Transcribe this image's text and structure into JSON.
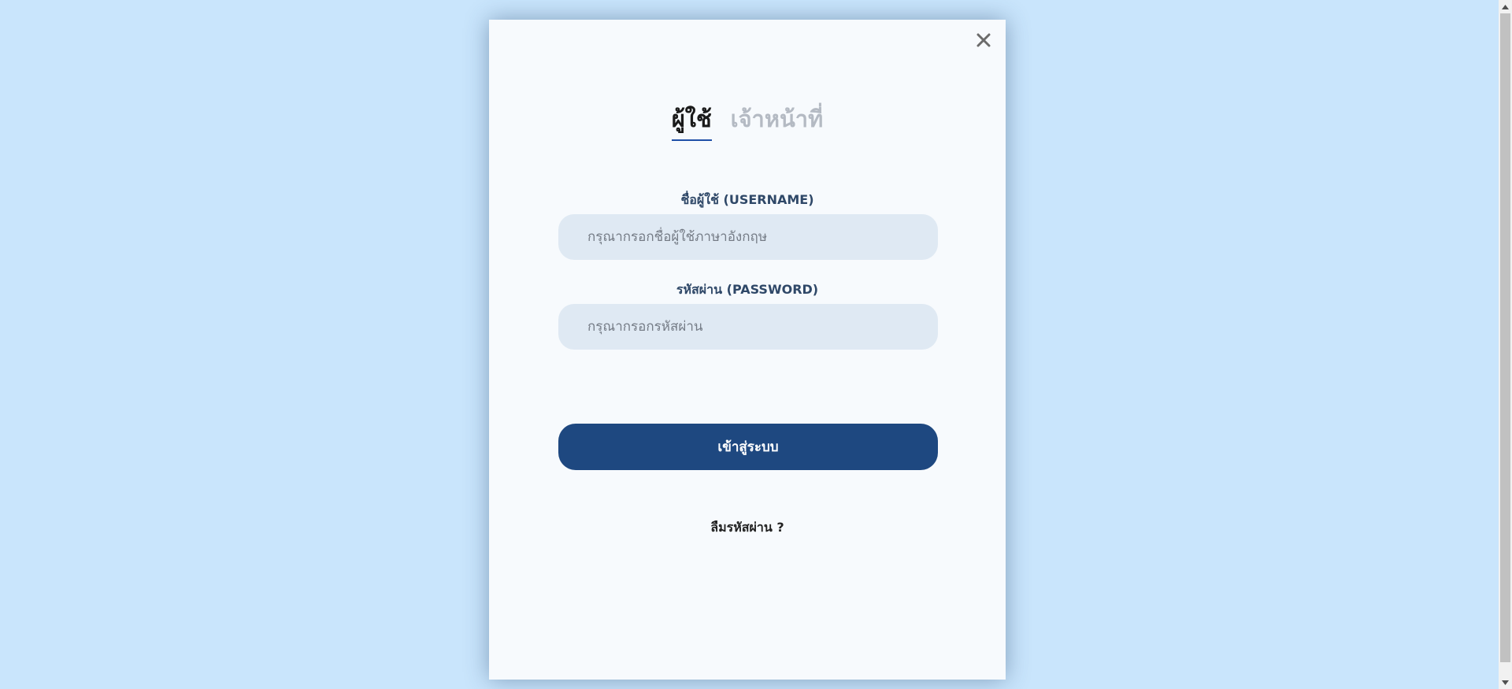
{
  "modal": {
    "close_icon": "close-icon",
    "tabs": [
      {
        "label": "ผู้ใช้",
        "active": true
      },
      {
        "label": "เจ้าหน้าที่",
        "active": false
      }
    ],
    "username": {
      "label": "ชื่อผู้ใช้ (USERNAME)",
      "placeholder": "กรุณากรอกชื่อผู้ใช้ภาษาอังกฤษ",
      "value": ""
    },
    "password": {
      "label": "รหัสผ่าน (PASSWORD)",
      "placeholder": "กรุณากรอกรหัสผ่าน",
      "value": ""
    },
    "login_label": "เข้าสู่ระบบ",
    "forgot_label": "ลืมรหัสผ่าน ?"
  },
  "colors": {
    "page_background": "#c9e5fc",
    "modal_background": "#f7fafd",
    "primary_button": "#1e4880",
    "input_background": "#dfe9f3",
    "active_tab_underline": "#1f4fa8",
    "inactive_tab": "#b4bac3"
  }
}
